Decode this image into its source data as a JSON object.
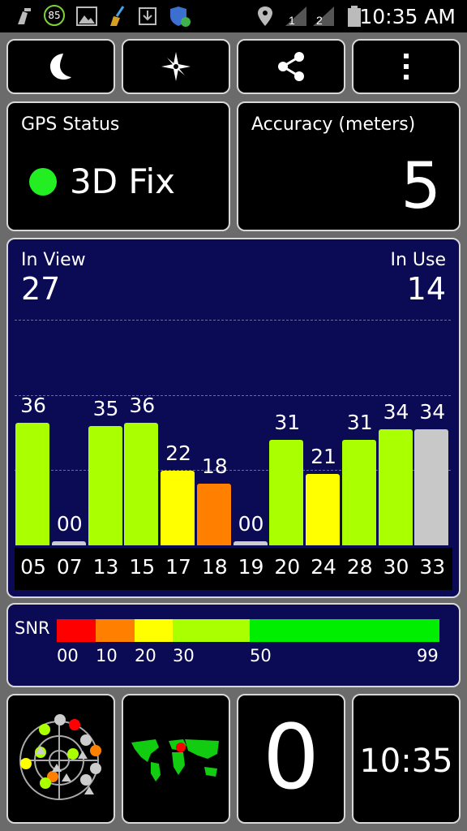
{
  "status_bar": {
    "battery_level": "85",
    "time": "10:35 AM",
    "icons": [
      "cleaner-icon",
      "battery-85-icon",
      "gallery-icon",
      "broom-icon",
      "download-icon",
      "shield-icon",
      "location-pin-icon",
      "signal-1-icon",
      "signal-2-icon",
      "battery-icon"
    ]
  },
  "toolbar": {
    "buttons": [
      {
        "name": "night-mode-button",
        "icon": "moon-icon"
      },
      {
        "name": "compass-button",
        "icon": "compass-star-icon"
      },
      {
        "name": "share-button",
        "icon": "share-icon"
      },
      {
        "name": "more-button",
        "icon": "overflow-menu-icon"
      }
    ]
  },
  "gps_status": {
    "label": "GPS Status",
    "value": "3D Fix",
    "indicator_color": "#22ee22"
  },
  "accuracy": {
    "label": "Accuracy (meters)",
    "value": "5"
  },
  "satellites": {
    "in_view_label": "In View",
    "in_view": "27",
    "in_use_label": "In Use",
    "in_use": "14"
  },
  "snr_legend": {
    "label": "SNR",
    "ticks": [
      "00",
      "10",
      "20",
      "30",
      "50",
      "99"
    ],
    "colors": [
      "#ff0000",
      "#ff8000",
      "#ffff00",
      "#aaff00",
      "#00ee00"
    ]
  },
  "bottom_tiles": {
    "speed": "0",
    "time": "10:35"
  },
  "chart_data": {
    "type": "bar",
    "categories": [
      "05",
      "07",
      "13",
      "15",
      "17",
      "18",
      "19",
      "20",
      "24",
      "28",
      "30",
      "33"
    ],
    "values": [
      36,
      0,
      35,
      36,
      22,
      18,
      0,
      31,
      21,
      31,
      34,
      34
    ],
    "value_labels": [
      "36",
      "00",
      "35",
      "36",
      "22",
      "18",
      "00",
      "31",
      "21",
      "31",
      "34",
      "34"
    ],
    "in_use": [
      true,
      false,
      true,
      true,
      true,
      true,
      false,
      true,
      true,
      true,
      true,
      false
    ],
    "colors": [
      "#aaff00",
      "#cccccc",
      "#aaff00",
      "#aaff00",
      "#ffff00",
      "#ff8000",
      "#cccccc",
      "#aaff00",
      "#ffff00",
      "#aaff00",
      "#aaff00",
      "#c8c8c8"
    ],
    "ylim": [
      0,
      60
    ],
    "grid": true
  }
}
